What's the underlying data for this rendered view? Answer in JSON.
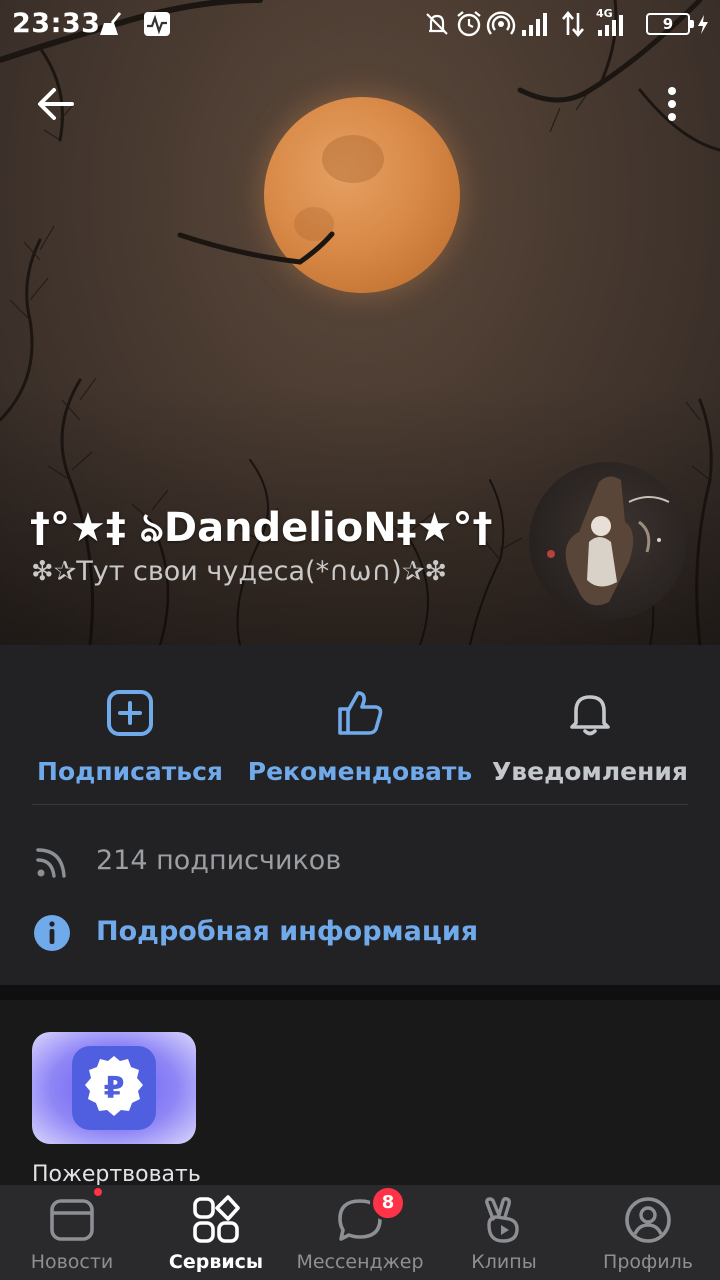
{
  "status_bar": {
    "time": "23:33",
    "network_label": "4G",
    "battery_level": "9",
    "icons": [
      "broom-icon",
      "activity-icon",
      "mute-icon",
      "alarm-icon",
      "hotspot-icon",
      "signal-icon",
      "data-arrows-icon",
      "signal-4g-icon",
      "battery-icon",
      "charging-icon"
    ]
  },
  "header": {
    "back_icon": "arrow-left-icon",
    "menu_icon": "more-vertical-icon"
  },
  "community": {
    "title": "†°★‡ ঌDandelioN‡★°†",
    "status": "❇✰Тут свои чудеса(*∩ω∩)✰❇"
  },
  "actions": [
    {
      "label": "Подписаться",
      "icon": "plus-square-icon",
      "color": "#71aaeb"
    },
    {
      "label": "Рекомендовать",
      "icon": "thumbs-up-icon",
      "color": "#71aaeb"
    },
    {
      "label": "Уведомления",
      "icon": "bell-icon",
      "color": "#c4c8cc"
    }
  ],
  "info": {
    "followers": "214 подписчиков",
    "details": "Подробная информация"
  },
  "services": {
    "donate_label": "Пожертвовать",
    "donate_symbol": "₽"
  },
  "tabs": [
    {
      "label": "Новости",
      "icon": "newsfeed-icon",
      "active": false,
      "dot": true
    },
    {
      "label": "Сервисы",
      "icon": "services-icon",
      "active": true
    },
    {
      "label": "Мессенджер",
      "icon": "message-icon",
      "active": false,
      "badge": "8"
    },
    {
      "label": "Клипы",
      "icon": "clips-icon",
      "active": false
    },
    {
      "label": "Профиль",
      "icon": "profile-icon",
      "active": false
    }
  ],
  "colors": {
    "accent": "#71aaeb",
    "background": "#19191a",
    "card": "#222224",
    "badge": "#ff3347"
  }
}
